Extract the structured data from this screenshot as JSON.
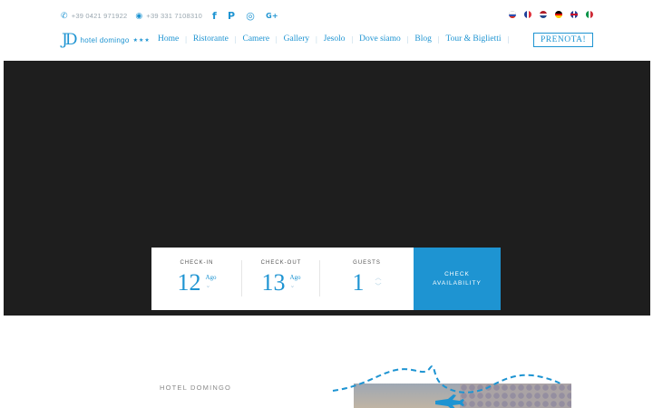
{
  "header": {
    "phone": "+39 0421 971922",
    "whatsapp": "+39 331 7108310",
    "social": [
      {
        "icon": "facebook-icon",
        "glyph": "f"
      },
      {
        "icon": "pinterest-icon",
        "glyph": "P"
      },
      {
        "icon": "instagram-icon",
        "glyph": "◎"
      },
      {
        "icon": "google-plus-icon",
        "glyph": "G+"
      }
    ],
    "languages": [
      "ru",
      "fr",
      "nl",
      "de",
      "en",
      "it"
    ]
  },
  "logo": {
    "mark": "JD",
    "name": "hotel domingo",
    "stars": "★★★"
  },
  "nav": {
    "items": [
      "Home",
      "Ristorante",
      "Camere",
      "Gallery",
      "Jesolo",
      "Dove siamo",
      "Blog",
      "Tour & Biglietti"
    ],
    "cta": "PRENOTA!"
  },
  "booking": {
    "checkin": {
      "label": "CHECK-IN",
      "day": "12",
      "month": "Ago"
    },
    "checkout": {
      "label": "CHECK-OUT",
      "day": "13",
      "month": "Ago"
    },
    "guests": {
      "label": "GUESTS",
      "value": "1"
    },
    "button": {
      "line1": "CHECK",
      "line2": "AVAILABILITY"
    }
  },
  "intro": {
    "label": "HOTEL DOMINGO"
  },
  "colors": {
    "accent": "#1e94d2",
    "hero": "#1e1e1e"
  }
}
